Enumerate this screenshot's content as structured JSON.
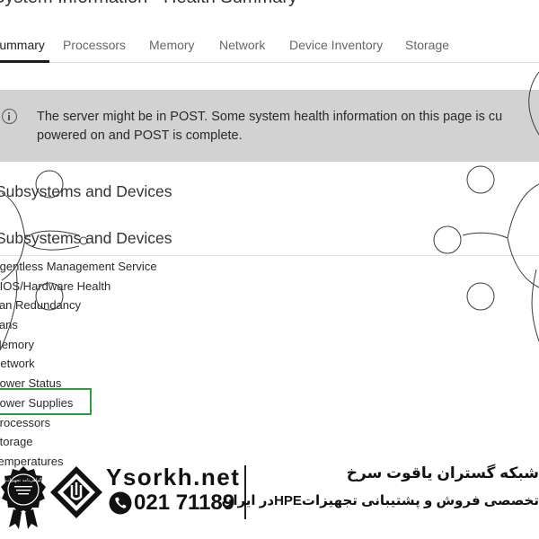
{
  "page": {
    "title": "System Information - Health Summary"
  },
  "tabs": [
    {
      "label": "Summary",
      "active": true
    },
    {
      "label": "Processors",
      "active": false
    },
    {
      "label": "Memory",
      "active": false
    },
    {
      "label": "Network",
      "active": false
    },
    {
      "label": "Device Inventory",
      "active": false
    },
    {
      "label": "Storage",
      "active": false
    }
  ],
  "alert": {
    "icon": "info-icon",
    "line1": "The server might be in POST. Some system health information on this page is cu",
    "line2": "powered on and POST is complete."
  },
  "sections": {
    "heading1": "Subsystems and Devices",
    "heading2": "Subsystems and Devices"
  },
  "subsystems": [
    "Agentless Management Service",
    "BIOS/Hardware Health",
    "Fan Redundancy",
    "Fans",
    "Memory",
    "Network",
    "Power Status",
    "Power Supplies",
    "Processors",
    "Storage",
    "Temperatures"
  ],
  "highlight": {
    "target": "Power Supplies",
    "color": "#2e9e3e"
  },
  "footer": {
    "brand": "Ysorkh.net",
    "phone": "021 71189",
    "company": "شبکه گستران یاقوت سرخ",
    "tagline": "تخصصی فروش و پشتیبانی تجهیزاتHPEدر ایران",
    "seal_text": "گواهی‌نامه تجهیزات"
  },
  "colors": {
    "alert_bg": "#d2d2d2",
    "active_tab_underline": "#1a1a1a",
    "highlight": "#2e9e3e"
  }
}
